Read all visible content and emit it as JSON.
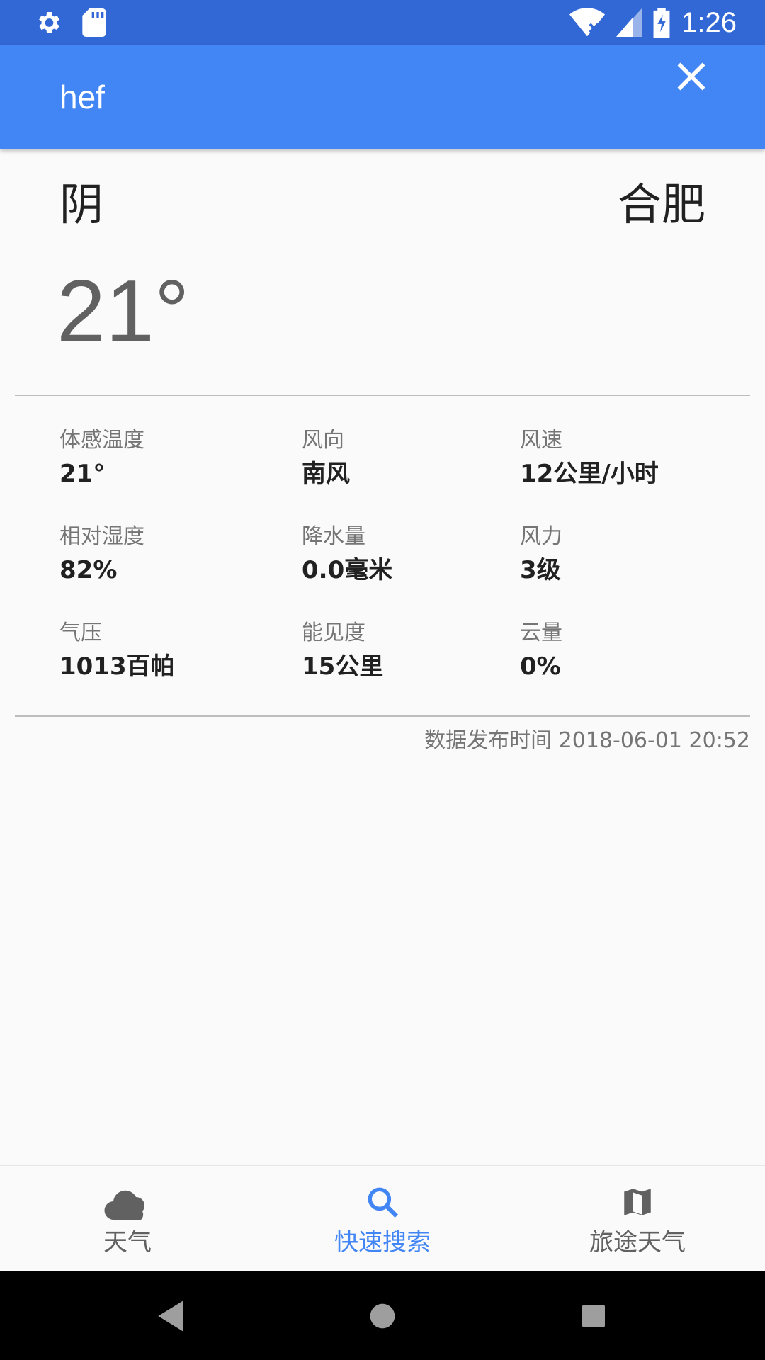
{
  "status_bar": {
    "time": "1:26",
    "icons": [
      "gear-icon",
      "sd-card-icon",
      "wifi-icon",
      "signal-icon",
      "battery-charging-icon"
    ]
  },
  "search": {
    "value": "hef",
    "clear_icon": "close-icon"
  },
  "weather": {
    "condition": "阴",
    "city": "合肥",
    "temperature": "21°"
  },
  "details": [
    {
      "label": "体感温度",
      "value": "21°"
    },
    {
      "label": "风向",
      "value": "南风"
    },
    {
      "label": "风速",
      "value": "12公里/小时"
    },
    {
      "label": "相对湿度",
      "value": "82%"
    },
    {
      "label": "降水量",
      "value": "0.0毫米"
    },
    {
      "label": "风力",
      "value": "3级"
    },
    {
      "label": "气压",
      "value": "1013百帕"
    },
    {
      "label": "能见度",
      "value": "15公里"
    },
    {
      "label": "云量",
      "value": "0%"
    }
  ],
  "publish_time": "数据发布时间 2018-06-01 20:52",
  "bottom_nav": {
    "items": [
      {
        "label": "天气",
        "icon": "cloud-icon",
        "active": false
      },
      {
        "label": "快速搜索",
        "icon": "search-icon",
        "active": true
      },
      {
        "label": "旅途天气",
        "icon": "map-icon",
        "active": false
      }
    ]
  },
  "colors": {
    "status_bar": "#3268d6",
    "app_bar": "#4285f4",
    "active": "#4285f4",
    "inactive": "#616161"
  }
}
